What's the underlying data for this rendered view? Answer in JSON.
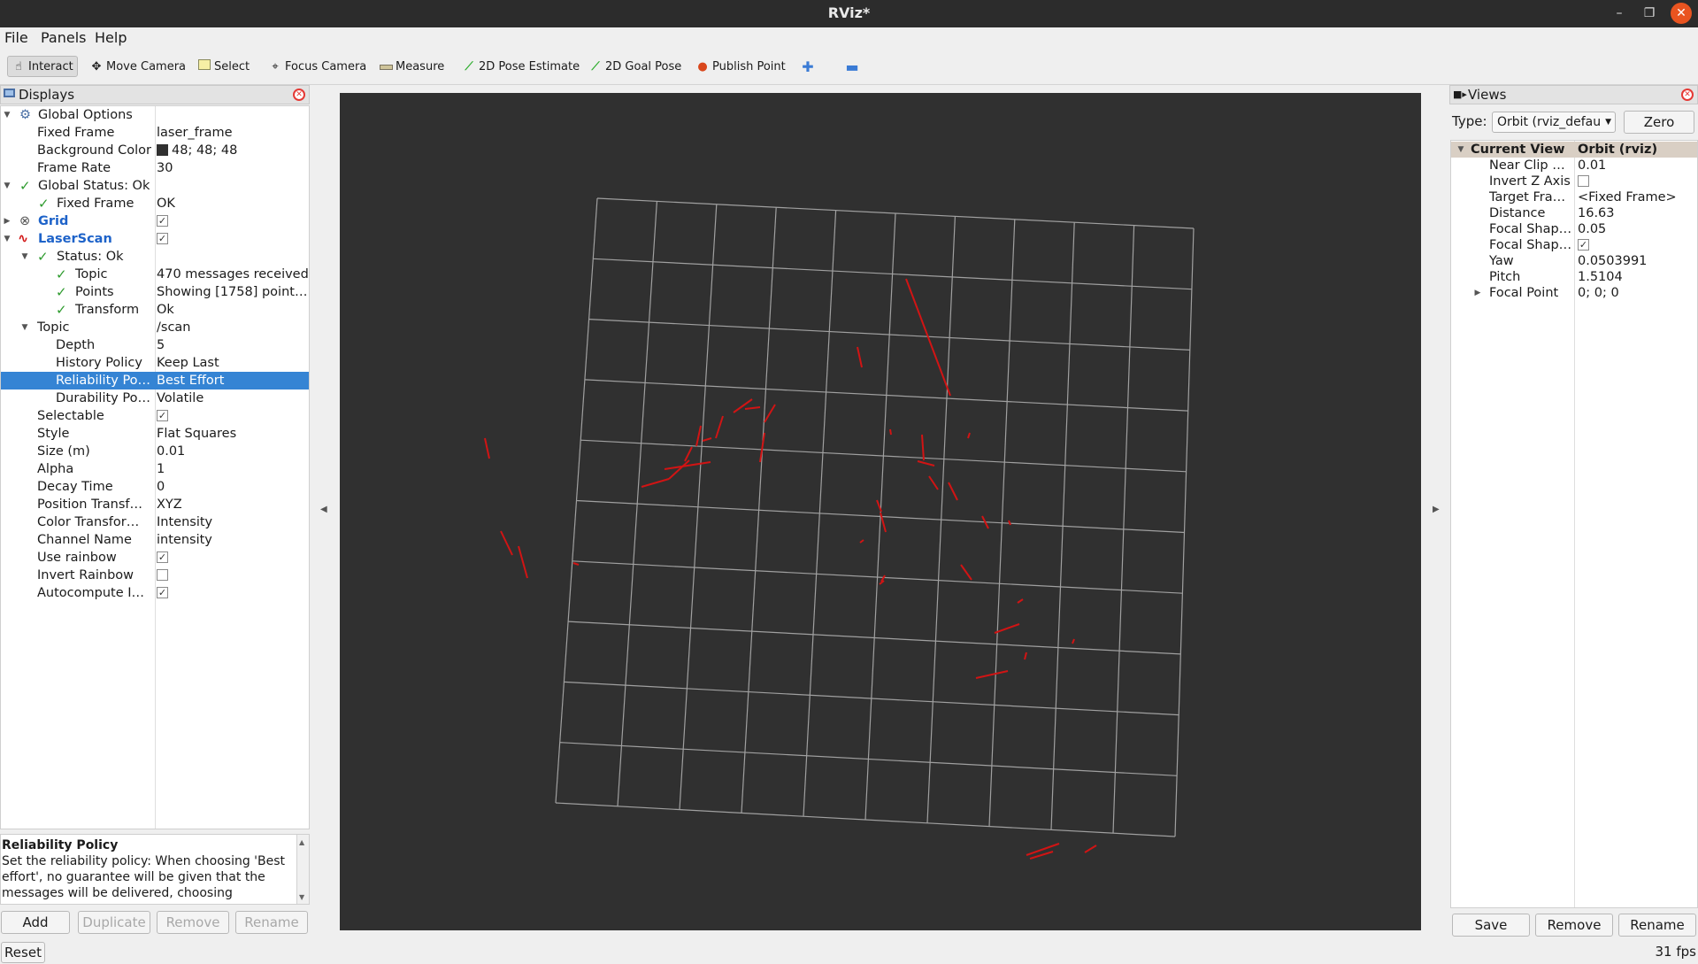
{
  "window": {
    "title": "RViz*"
  },
  "menu": [
    "File",
    "Panels",
    "Help"
  ],
  "toolbar": {
    "tools": [
      {
        "label": "Interact",
        "icon": "hand-icon"
      },
      {
        "label": "Move Camera",
        "icon": "move-camera-icon"
      },
      {
        "label": "Select",
        "icon": "select-icon"
      },
      {
        "label": "Focus Camera",
        "icon": "focus-camera-icon"
      },
      {
        "label": "Measure",
        "icon": "ruler-icon"
      },
      {
        "label": "2D Pose Estimate",
        "icon": "pose-arrow-icon"
      },
      {
        "label": "2D Goal Pose",
        "icon": "goal-arrow-icon"
      },
      {
        "label": "Publish Point",
        "icon": "map-pin-icon"
      }
    ]
  },
  "displays": {
    "title": "Displays",
    "rows": {
      "global_options": "Global Options",
      "fixed_frame": {
        "label": "Fixed Frame",
        "value": "laser_frame"
      },
      "background_color": {
        "label": "Background Color",
        "value": "48; 48; 48"
      },
      "frame_rate": {
        "label": "Frame Rate",
        "value": "30"
      },
      "global_status": "Global Status: Ok",
      "gs_fixed_frame": {
        "label": "Fixed Frame",
        "value": "OK"
      },
      "grid": "Grid",
      "laserscan": "LaserScan",
      "status": "Status: Ok",
      "st_topic": {
        "label": "Topic",
        "value": "470 messages received"
      },
      "st_points": {
        "label": "Points",
        "value": "Showing [1758] point…"
      },
      "st_transform": {
        "label": "Transform",
        "value": "Ok"
      },
      "topic": {
        "label": "Topic",
        "value": "/scan"
      },
      "depth": {
        "label": "Depth",
        "value": "5"
      },
      "history": {
        "label": "History Policy",
        "value": "Keep Last"
      },
      "reliability": {
        "label": "Reliability Po…",
        "value": "Best Effort"
      },
      "durability": {
        "label": "Durability Po…",
        "value": "Volatile"
      },
      "selectable": {
        "label": "Selectable"
      },
      "style": {
        "label": "Style",
        "value": "Flat Squares"
      },
      "size": {
        "label": "Size (m)",
        "value": "0.01"
      },
      "alpha": {
        "label": "Alpha",
        "value": "1"
      },
      "decay": {
        "label": "Decay Time",
        "value": "0"
      },
      "position": {
        "label": "Position Transf…",
        "value": "XYZ"
      },
      "color": {
        "label": "Color Transfor…",
        "value": "Intensity"
      },
      "channel": {
        "label": "Channel Name",
        "value": "intensity"
      },
      "rainbow": {
        "label": "Use rainbow"
      },
      "invert": {
        "label": "Invert Rainbow"
      },
      "autocompute": {
        "label": "Autocompute I…"
      }
    },
    "description": {
      "title": "Reliability Policy",
      "text": "Set the reliability policy: When choosing 'Best effort', no guarantee will be given that the messages will be delivered, choosing"
    },
    "buttons": {
      "add": "Add",
      "duplicate": "Duplicate",
      "remove": "Remove",
      "rename": "Rename"
    }
  },
  "views": {
    "title": "Views",
    "type_label": "Type:",
    "type_value": "Orbit (rviz_defau",
    "zero": "Zero",
    "header": {
      "label": "Current View",
      "value": "Orbit (rviz)"
    },
    "rows": [
      {
        "label": "Near Clip …",
        "value": "0.01"
      },
      {
        "label": "Invert Z Axis",
        "value": ""
      },
      {
        "label": "Target Fra…",
        "value": "<Fixed Frame>"
      },
      {
        "label": "Distance",
        "value": "16.63"
      },
      {
        "label": "Focal Shap…",
        "value": "0.05"
      },
      {
        "label": "Focal Shap…",
        "value": ""
      },
      {
        "label": "Yaw",
        "value": "0.0503991"
      },
      {
        "label": "Pitch",
        "value": "1.5104"
      },
      {
        "label": "Focal Point",
        "value": "0; 0; 0"
      }
    ],
    "buttons": {
      "save": "Save",
      "remove": "Remove",
      "rename": "Rename"
    }
  },
  "status": {
    "reset": "Reset",
    "fps": "31 fps"
  },
  "colors": {
    "viewport_bg": "#303030",
    "grid_line": "#a0a0a0",
    "scan": "#d11414",
    "selection": "#3584d4"
  }
}
